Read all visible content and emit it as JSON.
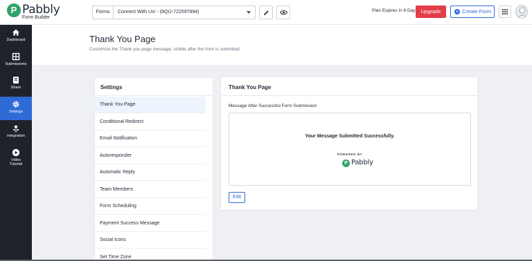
{
  "app": {
    "logo_text": "Pabbly",
    "logo_subtitle": "Form Builder"
  },
  "topbar": {
    "forms_label": "Forms",
    "selected_form": "Connect With Us! - (6QIJ-722597894)",
    "plan_text": "Plan Expires In 6 Day(s)",
    "upgrade_label": "Upgrade",
    "create_form_label": "Create Form",
    "colors": {
      "upgrade": "#e43d4a",
      "primary": "#2f6bd6",
      "brand_green": "#2fa36b"
    }
  },
  "sidebar": {
    "items": [
      {
        "label": "Dashboard",
        "icon": "home-icon"
      },
      {
        "label": "Submissions",
        "icon": "submissions-icon"
      },
      {
        "label": "Share",
        "icon": "share-icon"
      },
      {
        "label": "Settings",
        "icon": "gear-icon",
        "active": true
      },
      {
        "label": "Integration",
        "icon": "integration-icon"
      },
      {
        "label": "Video",
        "label2": "Tutorial",
        "icon": "play-icon"
      }
    ]
  },
  "page": {
    "title": "Thank You Page",
    "subtitle": "Customize the Thank you page message, visible after the form is submitted."
  },
  "settings": {
    "title": "Settings",
    "items": [
      "Thank You Page",
      "Conditional Redirect",
      "Email Notification",
      "Autoresponder",
      "Automatic Reply",
      "Team Members",
      "Form Scheduling",
      "Payment Success Message",
      "Social Icons",
      "Set Time Zone"
    ]
  },
  "thank_you": {
    "title": "Thank You Page",
    "field_label": "Message After Successful Form Submission",
    "message": "Your Message Submitted Successfully.",
    "powered_by": "POWERED BY",
    "powered_brand": "Pabbly",
    "edit_label": "Edit"
  }
}
